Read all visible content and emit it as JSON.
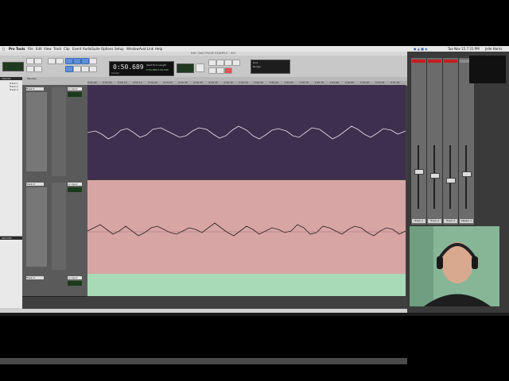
{
  "menubar": {
    "app": "Pro Tools",
    "menus": [
      "File",
      "Edit",
      "View",
      "Track",
      "Clip",
      "Event",
      "AudioSuite",
      "Options",
      "Setup",
      "Window",
      "Avid Link",
      "Help"
    ],
    "clock": "Tue Nov 15  7:31 PM",
    "user": "Jelle Harris"
  },
  "window": {
    "title": "Edit: DAS PHASE EXAMPLE - 001"
  },
  "transport": {
    "counter": "0:50.689",
    "counter_units": "Start  End  Length",
    "counter_extra": "0:50.689 0:00.000",
    "grid_label": "Grid",
    "nudge_label": "Nudge",
    "cursor_label": "Cursor"
  },
  "left_panels": {
    "tracks_title": "TRACKS",
    "groups_title": "GROUPS",
    "track_list": [
      "Track 1",
      "Track 2",
      "Track 3"
    ]
  },
  "edit": {
    "ruler_label": "Minutes",
    "ticks": [
      "0:50.00",
      "0:50.05",
      "0:50.10",
      "0:50.15",
      "0:50.20",
      "0:50.25",
      "0:50.30",
      "0:50.35",
      "0:50.40",
      "0:50.45",
      "0:50.50",
      "0:50.55",
      "0:50.60",
      "0:50.65",
      "0:50.70",
      "0:50.75",
      "0:50.80",
      "0:50.85",
      "0:50.90",
      "0:50.95",
      "0:51.00"
    ],
    "tracks": [
      {
        "name": "Track 1",
        "io": "no input",
        "waveform": "vol",
        "lane_color": "#3f2f4f"
      },
      {
        "name": "Track 2",
        "io": "no input",
        "waveform": "vol",
        "lane_color": "#d8a5a5"
      },
      {
        "name": "Track 3",
        "io": "no input",
        "waveform": "vol",
        "lane_color": "#a9dab7"
      }
    ]
  },
  "mixer": {
    "strips": [
      {
        "name": "Track 1",
        "fader": 0.62
      },
      {
        "name": "Track 2",
        "fader": 0.55
      },
      {
        "name": "Track 3",
        "fader": 0.48
      },
      {
        "name": "Master 1",
        "fader": 0.58
      }
    ]
  }
}
